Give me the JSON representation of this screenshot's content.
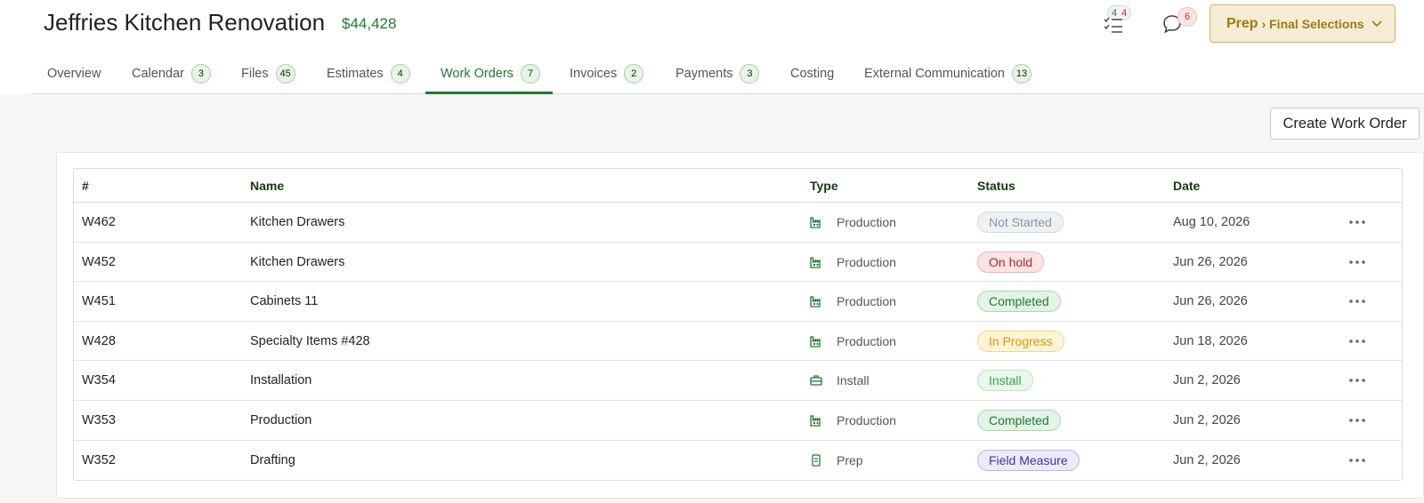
{
  "header": {
    "title": "Jeffries Kitchen Renovation",
    "amount": "$44,428",
    "tasks_complete": "4",
    "tasks_open": "4",
    "messages_count": "6",
    "stage_label": "Prep",
    "stage_sub": "› Final Selections"
  },
  "tabs": [
    {
      "label": "Overview",
      "count": ""
    },
    {
      "label": "Calendar",
      "count": "3"
    },
    {
      "label": "Files",
      "count": "45"
    },
    {
      "label": "Estimates",
      "count": "4"
    },
    {
      "label": "Work Orders",
      "count": "7"
    },
    {
      "label": "Invoices",
      "count": "2"
    },
    {
      "label": "Payments",
      "count": "3"
    },
    {
      "label": "Costing",
      "count": ""
    },
    {
      "label": "External Communication",
      "count": "13"
    }
  ],
  "active_tab": "Work Orders",
  "create_button": "Create Work Order",
  "table": {
    "columns": [
      "#",
      "Name",
      "Type",
      "Status",
      "Date"
    ],
    "rows": [
      {
        "id": "W462",
        "name": "Kitchen Drawers",
        "type": "Production",
        "type_icon": "factory-icon",
        "status": "Not Started",
        "status_style": "grey",
        "date": "Aug 10, 2026"
      },
      {
        "id": "W452",
        "name": "Kitchen Drawers",
        "type": "Production",
        "type_icon": "factory-icon",
        "status": "On hold",
        "status_style": "red",
        "date": "Jun 26, 2026"
      },
      {
        "id": "W451",
        "name": "Cabinets 11",
        "type": "Production",
        "type_icon": "factory-icon",
        "status": "Completed",
        "status_style": "green",
        "date": "Jun 26, 2026"
      },
      {
        "id": "W428",
        "name": "Specialty Items #428",
        "type": "Production",
        "type_icon": "factory-icon",
        "status": "In Progress",
        "status_style": "yellow",
        "date": "Jun 18, 2026"
      },
      {
        "id": "W354",
        "name": "Installation",
        "type": "Install",
        "type_icon": "toolbox-icon",
        "status": "Install",
        "status_style": "lightgreen",
        "date": "Jun 2, 2026"
      },
      {
        "id": "W353",
        "name": "Production",
        "type": "Production",
        "type_icon": "factory-icon",
        "status": "Completed",
        "status_style": "green",
        "date": "Jun 2, 2026"
      },
      {
        "id": "W352",
        "name": "Drafting",
        "type": "Prep",
        "type_icon": "clipboard-icon",
        "status": "Field Measure",
        "status_style": "purple",
        "date": "Jun 2, 2026"
      }
    ]
  },
  "colors": {
    "accent": "#1f7a2e",
    "stage_bg": "#f5ecd5",
    "stage_text": "#a07a12",
    "status": {
      "grey": {
        "bg": "#eef1f4",
        "border": "#d3d8de",
        "text": "#8a95a3"
      },
      "red": {
        "bg": "#fde4e4",
        "border": "#f0b3b3",
        "text": "#b3261e"
      },
      "green": {
        "bg": "#e3f3e6",
        "border": "#a8d6b0",
        "text": "#1f7a2e"
      },
      "yellow": {
        "bg": "#fff4d6",
        "border": "#f1d68a",
        "text": "#d19a06"
      },
      "lightgreen": {
        "bg": "#eaf8ec",
        "border": "#b6e3be",
        "text": "#2fa84a"
      },
      "purple": {
        "bg": "#eceaff",
        "border": "#b9b3ee",
        "text": "#3d35a3"
      }
    }
  }
}
